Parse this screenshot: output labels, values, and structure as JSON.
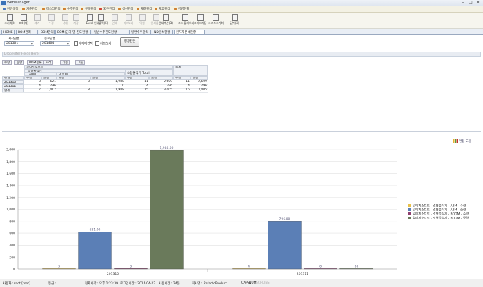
{
  "window": {
    "title": "WebManager",
    "btn_min": "–",
    "btn_max": "□",
    "btn_close": "×"
  },
  "menu": [
    {
      "label": "환경설정",
      "color": "#4a78c0"
    },
    {
      "label": "기준관리",
      "color": "#d08030"
    },
    {
      "label": "마스터관리",
      "color": "#d08030"
    },
    {
      "label": "수주관리",
      "color": "#d08030"
    },
    {
      "label": "구매관리",
      "color": "#d08030"
    },
    {
      "label": "외주관리",
      "color": "#d04030"
    },
    {
      "label": "생산관리",
      "color": "#d08030"
    },
    {
      "label": "재품관리",
      "color": "#d08030"
    },
    {
      "label": "재고관리",
      "color": "#d08030"
    },
    {
      "label": "경영현황",
      "color": "#d08030"
    }
  ],
  "toolbar": [
    {
      "label": "초기화(I)",
      "enabled": true
    },
    {
      "label": "조회(Q)",
      "enabled": true
    },
    {
      "label": "추가",
      "enabled": false
    },
    {
      "label": "수정",
      "enabled": false
    },
    {
      "label": "삭제",
      "enabled": false
    },
    {
      "label": "저장",
      "enabled": false
    },
    {
      "label": "Excel",
      "enabled": true
    },
    {
      "label": "인쇄출력(E)",
      "enabled": true
    },
    {
      "label": "인쇄",
      "enabled": false
    },
    {
      "label": "미리보기",
      "enabled": false
    },
    {
      "label": "엑셀",
      "enabled": false
    },
    {
      "label": "인쇄옵션",
      "enabled": false
    },
    {
      "label": "인쇄계산(D)",
      "enabled": true
    },
    {
      "label": "코드 불러오기",
      "enabled": true
    },
    {
      "label": "그리드저장",
      "enabled": true
    },
    {
      "label": "그리드초기화",
      "enabled": true
    },
    {
      "label": "닫기(X)",
      "enabled": true
    }
  ],
  "tabs": [
    {
      "label": "HOME",
      "active": false
    },
    {
      "label": "BOM관리",
      "active": false
    },
    {
      "label": "BOM관리",
      "active": false
    },
    {
      "label": "BOM(단가)별 진도현황",
      "active": false
    },
    {
      "label": "일반수주진도현황",
      "active": false
    },
    {
      "label": "일반수주관리",
      "active": false
    },
    {
      "label": "ND분석현황",
      "active": false
    },
    {
      "label": "원자재분석현황",
      "active": true
    }
  ],
  "params": {
    "start_label": "시작년월",
    "start_value": "201301",
    "end_label": "종료년월",
    "end_value": "201404",
    "opt1": "데이타전택",
    "opt2": "차트보기",
    "convert_btn": "형광전환"
  },
  "filter_zone": "Drop Filter Fields Here",
  "field_buttons": [
    "수량",
    "중량",
    "BOM종류",
    "거래",
    "기종",
    "그룹"
  ],
  "pivot": {
    "h_group": "말티지소프트",
    "h_sub": "소형물식기",
    "h_abm": "ABM",
    "h_bom": "BOOM",
    "h_total": "소형물식기 Total",
    "h_grand": "합계",
    "h_row": "년월",
    "col_qty": "수량",
    "col_wt": "중량",
    "rows": [
      {
        "label": "201310",
        "v": [
          "3",
          "621",
          "8",
          "1,988",
          "11",
          "2,609",
          "11",
          "2,609"
        ]
      },
      {
        "label": "201311",
        "v": [
          "4",
          "796",
          "",
          "0",
          "4",
          "796",
          "4",
          "796"
        ]
      },
      {
        "label": "합계",
        "v": [
          "7",
          "1,417",
          "8",
          "1,988",
          "15",
          "3,405",
          "15",
          "3,405"
        ]
      }
    ]
  },
  "chart_button": "편집 도움",
  "chart_data": {
    "type": "bar",
    "categories": [
      "201310",
      "201311"
    ],
    "ylim": [
      0,
      2000
    ],
    "yticks": [
      "0",
      "200",
      "400",
      "600",
      "800",
      "1,000",
      "1,200",
      "1,400",
      "1,600",
      "1,800",
      "2,000"
    ],
    "series": [
      {
        "name": "말티지소프트 - 소형물식기 - ABM - 수량",
        "color": "#e8c14a",
        "values": [
          3,
          4
        ],
        "labels": [
          "3",
          "4"
        ]
      },
      {
        "name": "말티지소프트 - 소형물식기 - ABM - 중량",
        "color": "#5b7fb6",
        "values": [
          621,
          796
        ],
        "labels": [
          "621.00",
          "796.00"
        ]
      },
      {
        "name": "말티지소프트 - 소형물식기 - BOOM - 수량",
        "color": "#8e3f6e",
        "values": [
          8,
          0
        ],
        "labels": [
          "8",
          "0"
        ]
      },
      {
        "name": "말티지소프트 - 소형물식기 - BOOM - 중량",
        "color": "#6a7a5b",
        "values": [
          1988,
          0
        ],
        "labels": [
          "1,988.00",
          "00"
        ]
      }
    ]
  },
  "status": {
    "user": "사용자 : root [root]",
    "level": "등급 :",
    "now": "현재시각 : 오후 1:23:39",
    "login": "로그인시간 : 2014-04-22",
    "elapsed": "사용시간 : 24분",
    "company": "회사명 : RefactoProduct",
    "caps": "CAPS",
    "num": "NUM",
    "scrl": "SCRL",
    "ins": "INS"
  }
}
